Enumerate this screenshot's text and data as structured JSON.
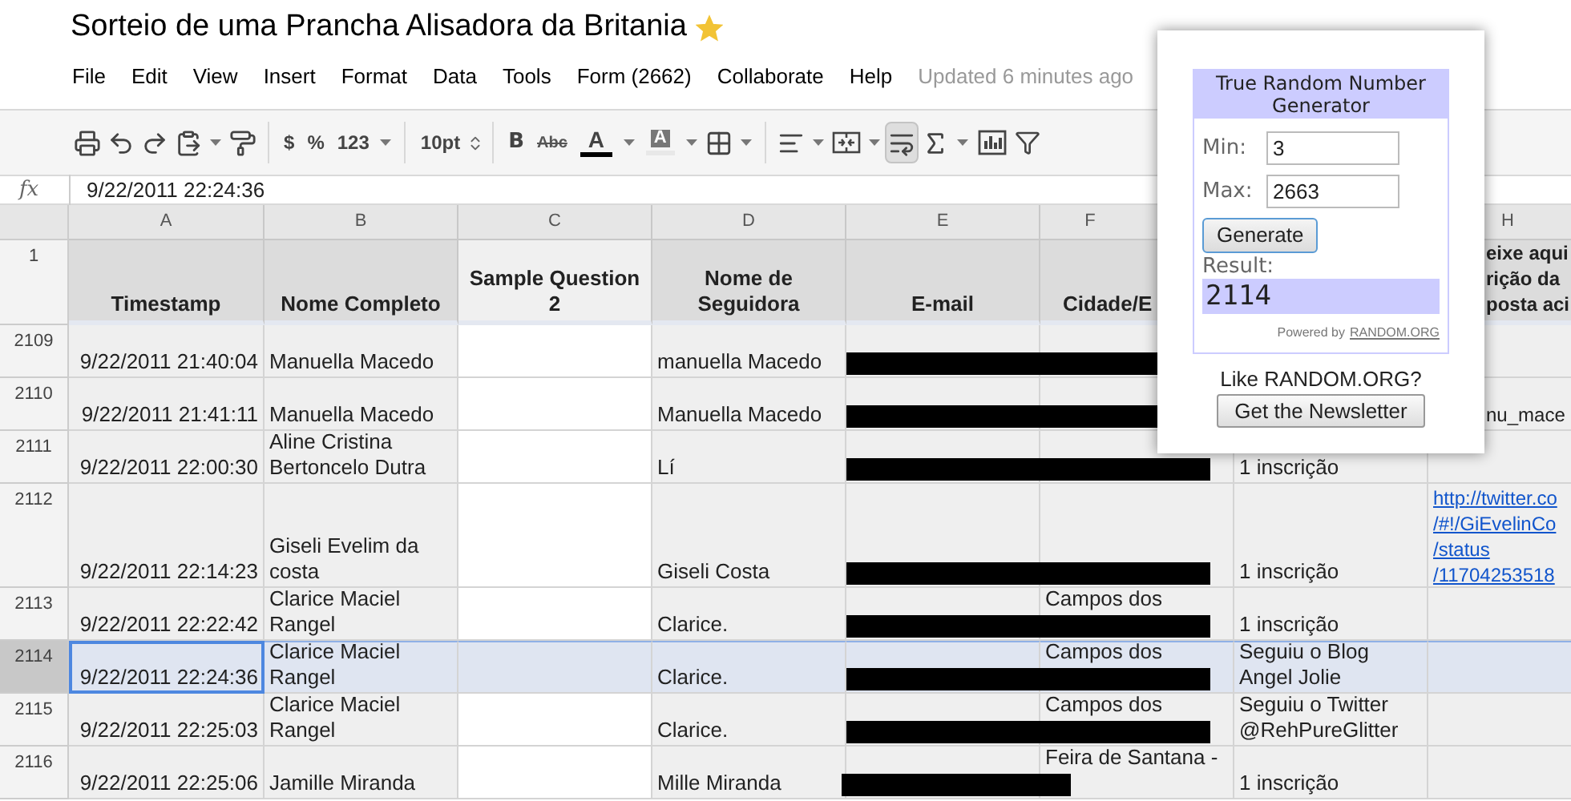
{
  "document": {
    "title": "Sorteio de uma Prancha Alisadora da Britania",
    "starred": true
  },
  "menu": [
    "File",
    "Edit",
    "View",
    "Insert",
    "Format",
    "Data",
    "Tools",
    "Form (2662)",
    "Collaborate",
    "Help"
  ],
  "last_edit": "Updated 6 minutes ago",
  "toolbar": {
    "labels": [
      "$",
      "%",
      "123",
      "10pt",
      "B",
      "Abc",
      "A",
      "A"
    ],
    "wrap_text_on": true
  },
  "formula_bar": {
    "label": "fx",
    "value": "9/22/2011 22:24:36"
  },
  "columns": [
    {
      "letter": "A",
      "heading": [
        "Timestamp"
      ],
      "shaded": true
    },
    {
      "letter": "B",
      "heading": [
        "Nome Completo"
      ],
      "shaded": true
    },
    {
      "letter": "C",
      "heading": [
        "Sample Question",
        "2"
      ],
      "shaded": false
    },
    {
      "letter": "D",
      "heading": [
        "Nome de",
        "Seguidora"
      ],
      "shaded": true
    },
    {
      "letter": "E",
      "heading": [
        "E-mail"
      ],
      "shaded": true
    },
    {
      "letter": "F",
      "heading": [
        "Cidade/E"
      ],
      "shaded": true
    },
    {
      "shaded": true
    },
    {
      "letter": "H",
      "heading": [
        "eixe aqui",
        "rição da",
        "posta aci"
      ],
      "shaded": true
    }
  ],
  "header_row": "1",
  "rows": [
    {
      "number": "2109",
      "selected": false,
      "redacted": true,
      "short_redaction": false,
      "tall": false,
      "cells": [
        "9/22/2011 21:40:04",
        "Manuella Macedo",
        null,
        "manuella Macedo",
        null,
        null,
        null,
        null
      ]
    },
    {
      "number": "2110",
      "selected": false,
      "redacted": true,
      "short_redaction": false,
      "tall": false,
      "cells": [
        "9/22/2011 21:41:11",
        "Manuella Macedo",
        null,
        "Manuella Macedo",
        null,
        null,
        null,
        "nu_mace"
      ]
    },
    {
      "number": "2111",
      "selected": false,
      "redacted": true,
      "short_redaction": false,
      "tall": false,
      "cells": [
        "9/22/2011 22:00:30",
        "Aline Cristina\nBertoncelo Dutra",
        null,
        "Lí",
        null,
        null,
        "1 inscrição",
        null
      ]
    },
    {
      "number": "2112",
      "selected": false,
      "redacted": true,
      "short_redaction": false,
      "tall": true,
      "cells": [
        "9/22/2011 22:14:23",
        "Giseli Evelim da\ncosta",
        null,
        "Giseli Costa",
        null,
        null,
        "1 inscrição",
        {
          "text": "http://twitter.co\n/#!/GiEvelinCo\n/status\n/11704253518",
          "kind": "link"
        }
      ]
    },
    {
      "number": "2113",
      "selected": false,
      "redacted": true,
      "short_redaction": false,
      "tall": false,
      "cells": [
        "9/22/2011 22:22:42",
        "Clarice Maciel\nRangel",
        null,
        "Clarice.",
        null,
        "Campos dos",
        "1 inscrição",
        null
      ]
    },
    {
      "number": "2114",
      "selected": true,
      "redacted": true,
      "short_redaction": false,
      "tall": false,
      "cells": [
        "9/22/2011 22:24:36",
        "Clarice Maciel\nRangel",
        null,
        "Clarice.",
        null,
        "Campos dos",
        "Seguiu o Blog\nAngel Jolie",
        null
      ]
    },
    {
      "number": "2115",
      "selected": false,
      "redacted": true,
      "short_redaction": false,
      "tall": false,
      "cells": [
        "9/22/2011 22:25:03",
        "Clarice Maciel\nRangel",
        null,
        "Clarice.",
        null,
        "Campos dos",
        "Seguiu o Twitter\n@RehPureGlitter",
        null
      ]
    },
    {
      "number": "2116",
      "selected": false,
      "redacted": true,
      "short_redaction": true,
      "tall": false,
      "cells": [
        "9/22/2011 22:25:06",
        "Jamille Miranda",
        null,
        "Mille Miranda",
        null,
        "Feira de Santana -",
        "1 inscrição",
        null
      ]
    }
  ],
  "random_widget": {
    "title": "True Random Number Generator",
    "min_label": "Min:",
    "min_value": "3",
    "max_label": "Max:",
    "max_value": "2663",
    "generate": "Generate",
    "result_label": "Result:",
    "result": "2114",
    "powered_by": "Powered by",
    "powered_link": "RANDOM.ORG",
    "like": "Like RANDOM.ORG?",
    "newsletter": "Get the Newsletter"
  }
}
